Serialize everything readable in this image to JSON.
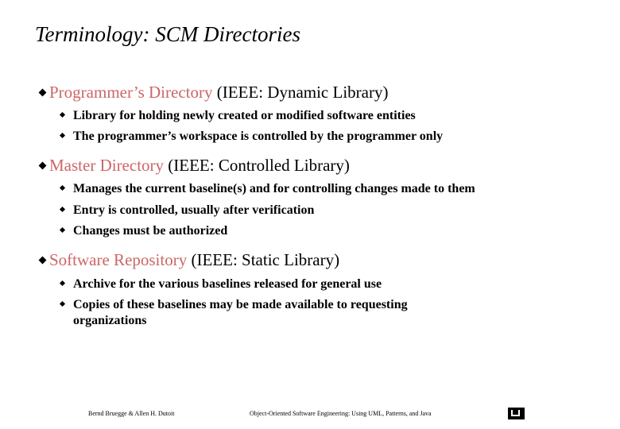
{
  "slide": {
    "title": "Terminology: SCM Directories",
    "accent_color": "#cc6666",
    "sections": [
      {
        "term": "Programmer’s Directory",
        "ieee": " (IEEE: Dynamic Library)",
        "points": [
          "Library for holding newly created or modified software entities",
          "The programmer’s workspace is controlled by the programmer only"
        ]
      },
      {
        "term": "Master Directory",
        "ieee": " (IEEE: Controlled Library)",
        "points": [
          "Manages the current baseline(s) and for controlling changes made to them",
          "Entry is controlled, usually after verification",
          "Changes must be authorized"
        ]
      },
      {
        "term": "Software Repository",
        "ieee": " (IEEE: Static Library)",
        "points": [
          "Archive for the various baselines released for general use",
          "Copies of these baselines may be made available to requesting",
          "organizations"
        ]
      }
    ],
    "footer": {
      "authors": "Bernd Bruegge & Allen H. Dutoit",
      "book": "Object-Oriented Software Engineering: Using UML, Patterns, and Java",
      "logo_icon": "tum-logo-icon"
    }
  }
}
